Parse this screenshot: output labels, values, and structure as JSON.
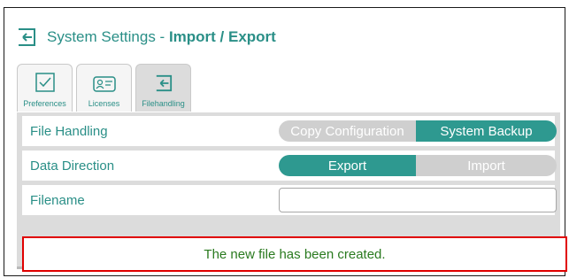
{
  "header": {
    "title_prefix": "System Settings - ",
    "title_bold": "Import / Export",
    "icon": "file-import-icon"
  },
  "tabs": [
    {
      "label": "Preferences",
      "icon": "checkbox-icon",
      "active": false
    },
    {
      "label": "Licenses",
      "icon": "license-card-icon",
      "active": false
    },
    {
      "label": "Filehandling",
      "icon": "file-import-icon",
      "active": true
    }
  ],
  "rows": {
    "file_handling": {
      "label": "File Handling",
      "options": [
        "Copy Configuration",
        "System Backup"
      ],
      "selected": "System Backup"
    },
    "data_direction": {
      "label": "Data Direction",
      "options": [
        "Export",
        "Import"
      ],
      "selected": "Export"
    },
    "filename": {
      "label": "Filename",
      "value": ""
    }
  },
  "message": {
    "text": "The new file has been created."
  },
  "colors": {
    "accent": "#2e9990",
    "text_accent": "#2a8f87",
    "success_text": "#2a7a1f",
    "alert_border": "#e00000"
  }
}
